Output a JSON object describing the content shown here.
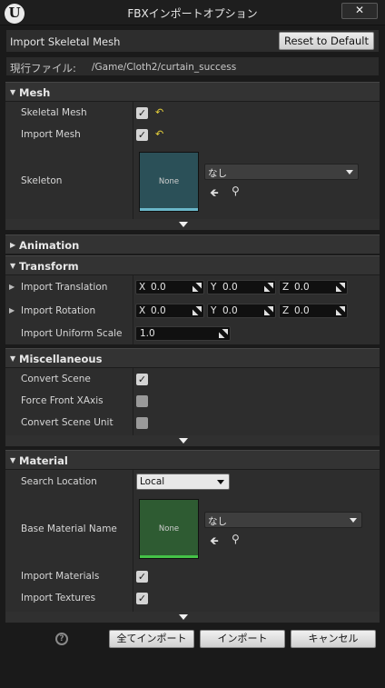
{
  "window": {
    "title": "FBXインポートオプション",
    "close_glyph": "✕",
    "logo_glyph": "U"
  },
  "header": {
    "import_title": "Import Skeletal Mesh",
    "reset_label": "Reset to Default"
  },
  "file": {
    "label": "現行ファイル:",
    "path": "/Game/Cloth2/curtain_success"
  },
  "mesh": {
    "title": "Mesh",
    "skeletal_mesh_label": "Skeletal Mesh",
    "skeletal_mesh_checked": true,
    "import_mesh_label": "Import Mesh",
    "import_mesh_checked": true,
    "skeleton_label": "Skeleton",
    "skeleton_thumb": "None",
    "skeleton_value": "なし"
  },
  "animation": {
    "title": "Animation"
  },
  "transform": {
    "title": "Transform",
    "translation_label": "Import Translation",
    "translation": {
      "x": "0.0",
      "y": "0.0",
      "z": "0.0"
    },
    "rotation_label": "Import Rotation",
    "rotation": {
      "x": "0.0",
      "y": "0.0",
      "z": "0.0"
    },
    "scale_label": "Import Uniform Scale",
    "scale": "1.0",
    "axis_x": "X",
    "axis_y": "Y",
    "axis_z": "Z"
  },
  "misc": {
    "title": "Miscellaneous",
    "convert_scene_label": "Convert Scene",
    "convert_scene_checked": true,
    "force_front_label": "Force Front XAxis",
    "force_front_checked": false,
    "convert_unit_label": "Convert Scene Unit",
    "convert_unit_checked": false
  },
  "material": {
    "title": "Material",
    "search_location_label": "Search Location",
    "search_location_value": "Local",
    "base_material_label": "Base Material Name",
    "base_material_thumb": "None",
    "base_material_value": "なし",
    "import_materials_label": "Import Materials",
    "import_materials_checked": true,
    "import_textures_label": "Import Textures",
    "import_textures_checked": true
  },
  "footer": {
    "import_all": "全てインポート",
    "import": "インポート",
    "cancel": "キャンセル",
    "help_glyph": "?"
  },
  "colors": {
    "skeleton_thumb": "#2b5058",
    "skeleton_thumb_bar": "#6ab7c9",
    "material_thumb": "#2e5b32",
    "material_thumb_bar": "#44c247",
    "reset_arrow": "#e8d23a"
  }
}
